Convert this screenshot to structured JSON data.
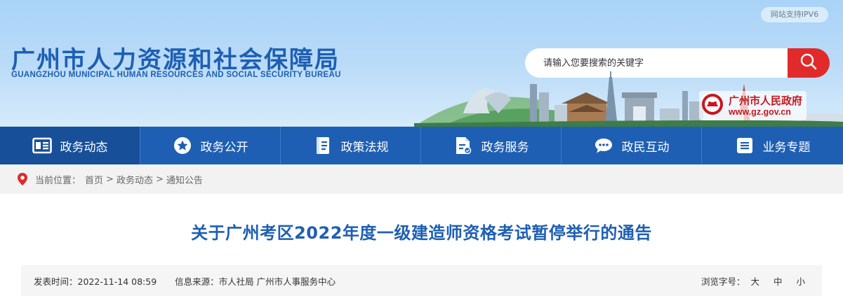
{
  "header": {
    "title_cn": "广州市人力资源和社会保障局",
    "title_en": "GUANGZHOU MUNICIPAL HUMAN RESOURCES AND SOCIAL SECURITY BUREAU",
    "ipv6_badge": "网站支持IPV6",
    "gov_link_cn": "广州市人民政府",
    "gov_link_url": "www.gz.gov.cn",
    "colors": {
      "brand_blue": "#1e5fb3",
      "search_red": "#e12a2a",
      "gov_red": "#c8161d"
    }
  },
  "search": {
    "placeholder": "请输入您要搜索的关键字",
    "icon": "search-icon"
  },
  "nav": {
    "items": [
      {
        "label": "政务动态",
        "icon": "news-icon",
        "active": true
      },
      {
        "label": "政务公开",
        "icon": "star-icon"
      },
      {
        "label": "政策法规",
        "icon": "book-icon"
      },
      {
        "label": "政务服务",
        "icon": "service-doc-icon"
      },
      {
        "label": "政民互动",
        "icon": "chat-icon"
      },
      {
        "label": "业务专题",
        "icon": "list-icon"
      }
    ]
  },
  "breadcrumb": {
    "prefix": "当前位置：",
    "items": [
      "首页",
      "政务动态",
      "通知公告"
    ],
    "separator": ">"
  },
  "article": {
    "title": "关于广州考区2022年度一级建造师资格考试暂停举行的通告",
    "publish_label": "发表时间：",
    "publish_time": "2022-11-14 08:59",
    "source_label": "信息来源：",
    "source": "市人社局 广州市人事服务中心",
    "fontsize_label": "浏览字号：",
    "fontsize_options": [
      "大",
      "中",
      "小"
    ]
  }
}
